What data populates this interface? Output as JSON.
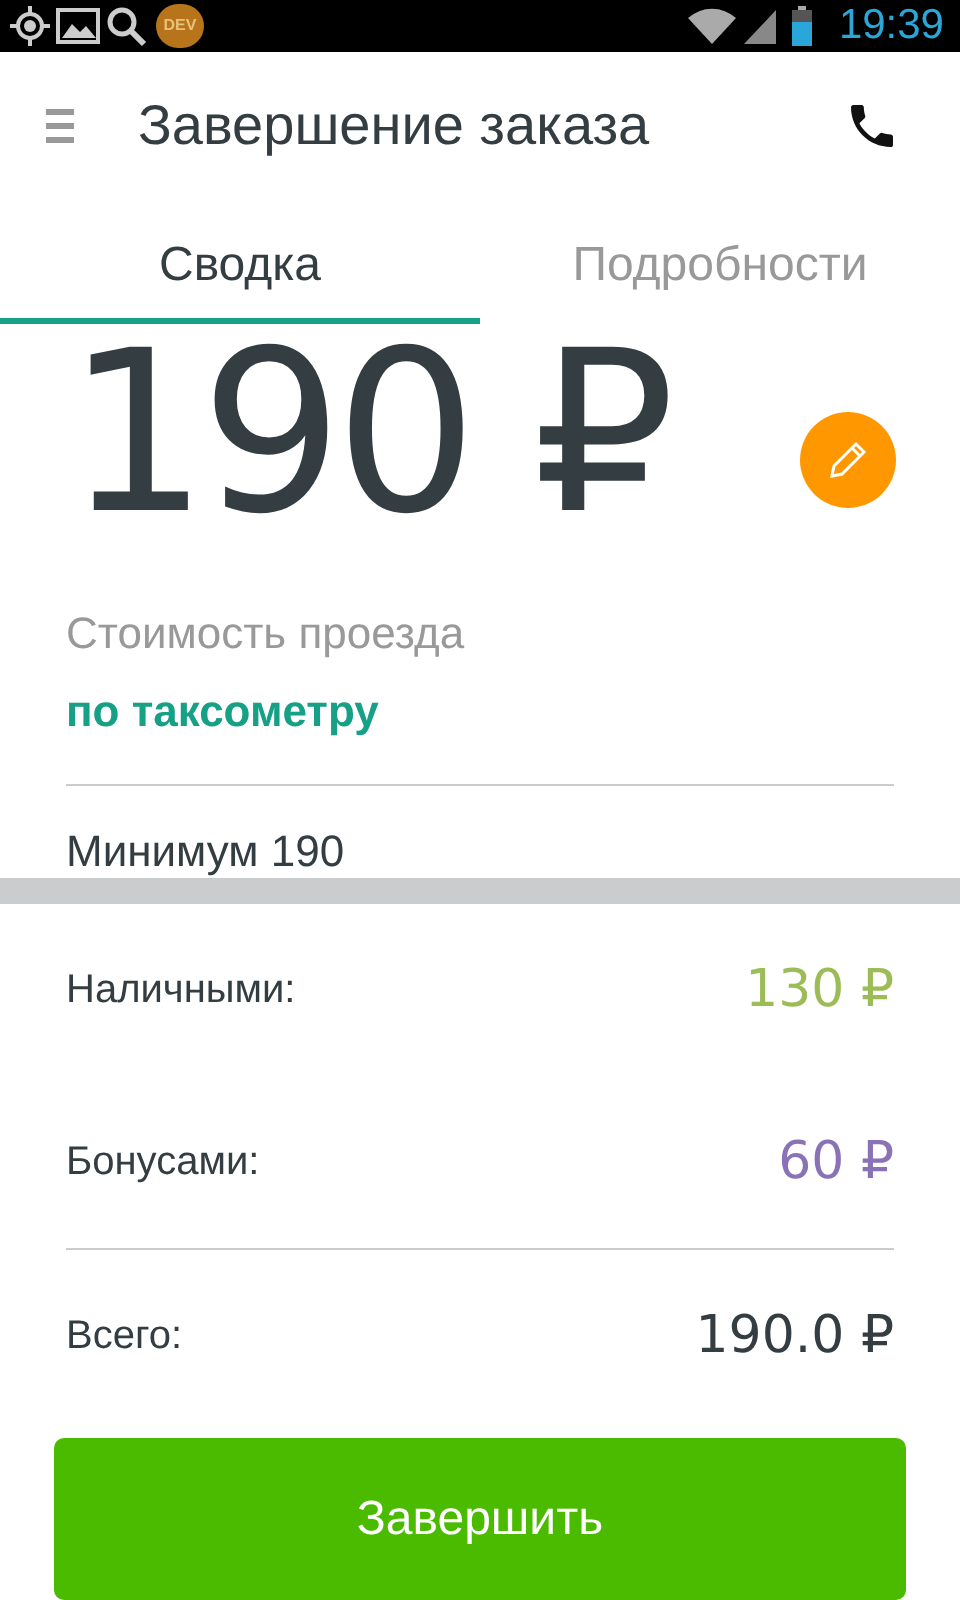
{
  "status_bar": {
    "badge": "DEV",
    "time": "19:39"
  },
  "toolbar": {
    "title": "Завершение заказа"
  },
  "tabs": [
    {
      "label": "Сводка",
      "selected": true
    },
    {
      "label": "Подробности",
      "selected": false
    }
  ],
  "fare": {
    "amount": "190 ₽",
    "label": "Стоимость проезда",
    "mode": "по таксометру",
    "minimum": "Минимум 190"
  },
  "payments": [
    {
      "label": "Наличными:",
      "amount": "130 ₽",
      "color": "#9cbc57"
    },
    {
      "label": "Бонусами:",
      "amount": "60 ₽",
      "color": "#8a72b6"
    },
    {
      "label": "Всего:",
      "amount": "190.0 ₽",
      "color": "#333d42"
    }
  ],
  "button": {
    "label": "Завершить"
  }
}
